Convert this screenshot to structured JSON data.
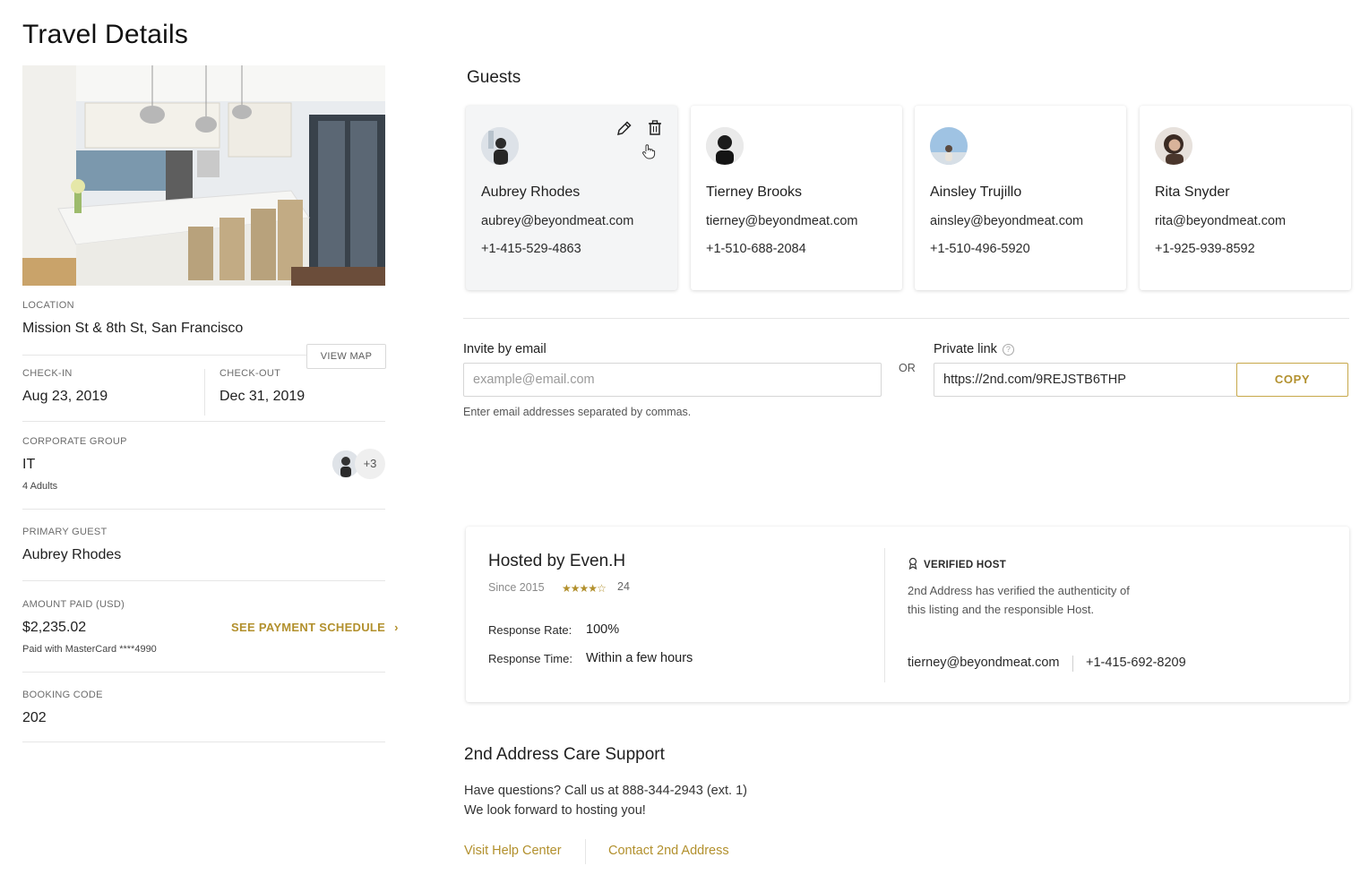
{
  "page": {
    "title": "Travel Details"
  },
  "booking": {
    "location_label": "LOCATION",
    "location": "Mission St & 8th St, San Francisco",
    "view_map": "VIEW MAP",
    "checkin_label": "CHECK-IN",
    "checkin": "Aug 23, 2019",
    "checkout_label": "CHECK-OUT",
    "checkout": "Dec 31, 2019",
    "group_label": "CORPORATE GROUP",
    "group": "IT",
    "group_size": "4 Adults",
    "group_more": "+3",
    "primary_label": "PRIMARY GUEST",
    "primary": "Aubrey Rhodes",
    "amount_label": "AMOUNT PAID (USD)",
    "amount": "$2,235.02",
    "paid_with": "Paid with MasterCard ****4990",
    "payment_schedule": "SEE PAYMENT SCHEDULE",
    "code_label": "BOOKING CODE",
    "code": "202"
  },
  "guests": {
    "title": "Guests",
    "items": [
      {
        "name": "Aubrey Rhodes",
        "email": "aubrey@beyondmeat.com",
        "phone": "+1-415-529-4863"
      },
      {
        "name": "Tierney Brooks",
        "email": "tierney@beyondmeat.com",
        "phone": "+1-510-688-2084"
      },
      {
        "name": "Ainsley Trujillo",
        "email": "ainsley@beyondmeat.com",
        "phone": "+1-510-496-5920"
      },
      {
        "name": "Rita Snyder",
        "email": "rita@beyondmeat.com",
        "phone": "+1-925-939-8592"
      }
    ]
  },
  "invite": {
    "email_label": "Invite by email",
    "email_placeholder": "example@email.com",
    "email_hint": "Enter email addresses separated by commas.",
    "or": "OR",
    "link_label": "Private link",
    "link_value": "https://2nd.com/9REJSTB6THP",
    "copy": "COPY"
  },
  "host": {
    "title": "Hosted by Even.H",
    "since": "Since 2015",
    "rating": 4,
    "rating_max": 5,
    "review_count": "24",
    "response_rate_label": "Response Rate:",
    "response_rate": "100%",
    "response_time_label": "Response Time:",
    "response_time": "Within a few hours",
    "verified_label": "VERIFIED HOST",
    "verified_text_1": "2nd Address has verified the authenticity of",
    "verified_text_2": "this listing and the responsible Host.",
    "email": "tierney@beyondmeat.com",
    "phone": "+1-415-692-8209"
  },
  "support": {
    "title": "2nd Address Care Support",
    "line1": "Have questions? Call us at 888-344-2943 (ext. 1)",
    "line2": "We look forward to hosting you!",
    "help_center": "Visit Help Center",
    "contact": "Contact 2nd Address"
  },
  "colors": {
    "accent": "#b2902d",
    "text": "#1f1f1f",
    "muted": "#6c6c6c"
  }
}
